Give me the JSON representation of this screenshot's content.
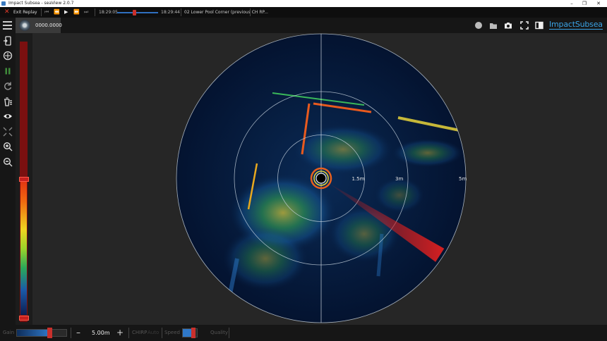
{
  "window": {
    "title": "Impact Subsea - seaView 2.0.7"
  },
  "replay": {
    "exit_label": "Exit Replay",
    "start_time": "18:29:05",
    "end_time": "18:29:44",
    "position_fraction": 0.41,
    "file_name": "02 Lower Pool Corner (previous CH RP..."
  },
  "device": {
    "value": "0000.0000"
  },
  "brand": {
    "name": "ImpactSubsea",
    "color": "#3aa3e6"
  },
  "scale": {
    "upper_fraction": 0.49,
    "lower_fraction": 0.0
  },
  "sonar": {
    "range_labels": [
      "1.5m",
      "3m",
      "5m"
    ],
    "heading_deg": 123,
    "ring_fractions": [
      0.3,
      0.6,
      1.0
    ]
  },
  "bottom": {
    "gain_label": "Gain",
    "gain_fraction": 0.65,
    "range_value": "5.00m",
    "chirp_label": "CHIRP",
    "chirp_state": "Auto",
    "speed_label": "Speed",
    "speed_fraction": 0.65,
    "quality_label": "Quality"
  }
}
